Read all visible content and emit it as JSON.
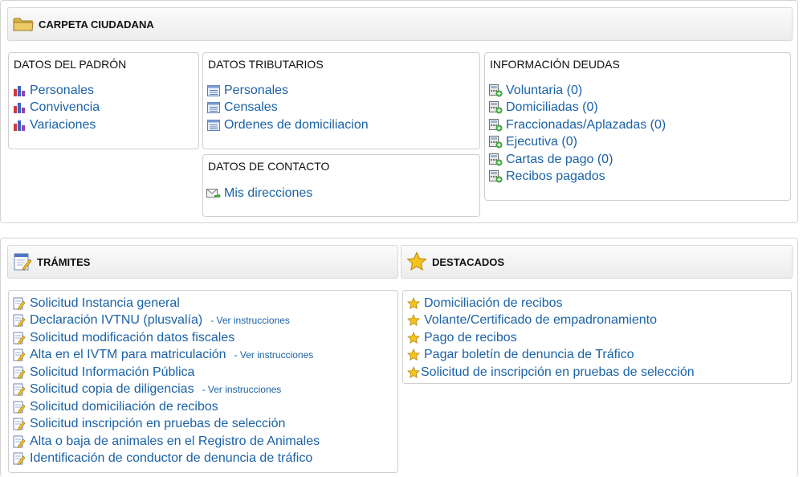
{
  "carpeta": {
    "title": "CARPETA CIUDADANA",
    "padron": {
      "title": "DATOS DEL PADRÓN",
      "items": [
        {
          "label": "Personales"
        },
        {
          "label": "Convivencia"
        },
        {
          "label": "Variaciones"
        }
      ]
    },
    "tributarios": {
      "title": "DATOS TRIBUTARIOS",
      "items": [
        {
          "label": "Personales"
        },
        {
          "label": "Censales"
        },
        {
          "label": "Ordenes de domiciliacion"
        }
      ]
    },
    "contacto": {
      "title": "DATOS DE CONTACTO",
      "items": [
        {
          "label": "Mis direcciones"
        }
      ]
    },
    "deudas": {
      "title": "INFORMACIÓN DEUDAS",
      "items": [
        {
          "label": "Voluntaria (0)"
        },
        {
          "label": "Domiciliadas (0)"
        },
        {
          "label": "Fraccionadas/Aplazadas (0)"
        },
        {
          "label": "Ejecutiva (0)"
        },
        {
          "label": "Cartas de pago (0)"
        },
        {
          "label": "Recibos pagados"
        }
      ]
    }
  },
  "tramites": {
    "title": "TRÁMITES",
    "items": [
      {
        "label": "Solicitud Instancia general",
        "sub": ""
      },
      {
        "label": "Declaración IVTNU (plusvalía)",
        "sub": "- Ver instrucciones"
      },
      {
        "label": "Solicitud modificación datos fiscales",
        "sub": ""
      },
      {
        "label": "Alta en el IVTM para matriculación",
        "sub": "- Ver instrucciones"
      },
      {
        "label": "Solicitud Información Pública",
        "sub": ""
      },
      {
        "label": "Solicitud copia de diligencias",
        "sub": "- Ver instrucciones"
      },
      {
        "label": "Solicitud domiciliación de recibos",
        "sub": ""
      },
      {
        "label": "Solicitud inscripción en pruebas de selección",
        "sub": ""
      },
      {
        "label": "Alta o baja de animales en el Registro de Animales",
        "sub": ""
      },
      {
        "label": "Identificación de conductor de denuncia de tráfico",
        "sub": ""
      }
    ]
  },
  "destacados": {
    "title": "DESTACADOS",
    "items": [
      {
        "label": "Domiciliación de recibos"
      },
      {
        "label": "Volante/Certificado de empadronamiento"
      },
      {
        "label": "Pago de recibos"
      },
      {
        "label": "Pagar boletín de denuncia de Tráfico"
      },
      {
        "label": "Solicitud de inscripción en pruebas de selección"
      }
    ]
  },
  "icons": {
    "carpeta": "folder-icon",
    "padron": "bar-chart-icon",
    "tributarios": "document-list-icon",
    "contacto": "mail-forward-icon",
    "deudas": "calculator-plus-icon",
    "tramites_header": "notepad-icon",
    "tramites_item": "edit-document-icon",
    "destacados": "star-icon"
  },
  "colors": {
    "link": "#1a62a6",
    "header_bg": "#eeeeee",
    "border": "#d4d4d4"
  }
}
